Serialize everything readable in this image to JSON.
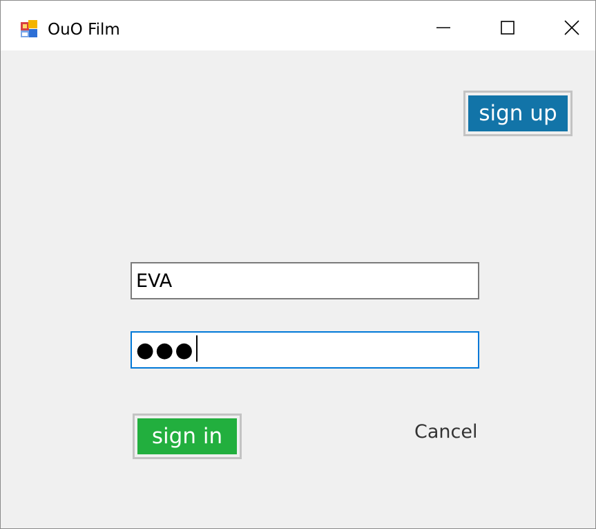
{
  "window": {
    "title": "OuO Film",
    "icon": "form-app-icon"
  },
  "title_controls": {
    "minimize_icon": "minimize-icon",
    "maximize_icon": "maximize-icon",
    "close_icon": "close-icon"
  },
  "buttons": {
    "signup_label": "sign up",
    "signup_color": "#1274a8",
    "signin_label": "sign in",
    "signin_color": "#22af3e",
    "cancel_label": "Cancel"
  },
  "form": {
    "username_value": "EVA",
    "password_value": "●●●"
  }
}
